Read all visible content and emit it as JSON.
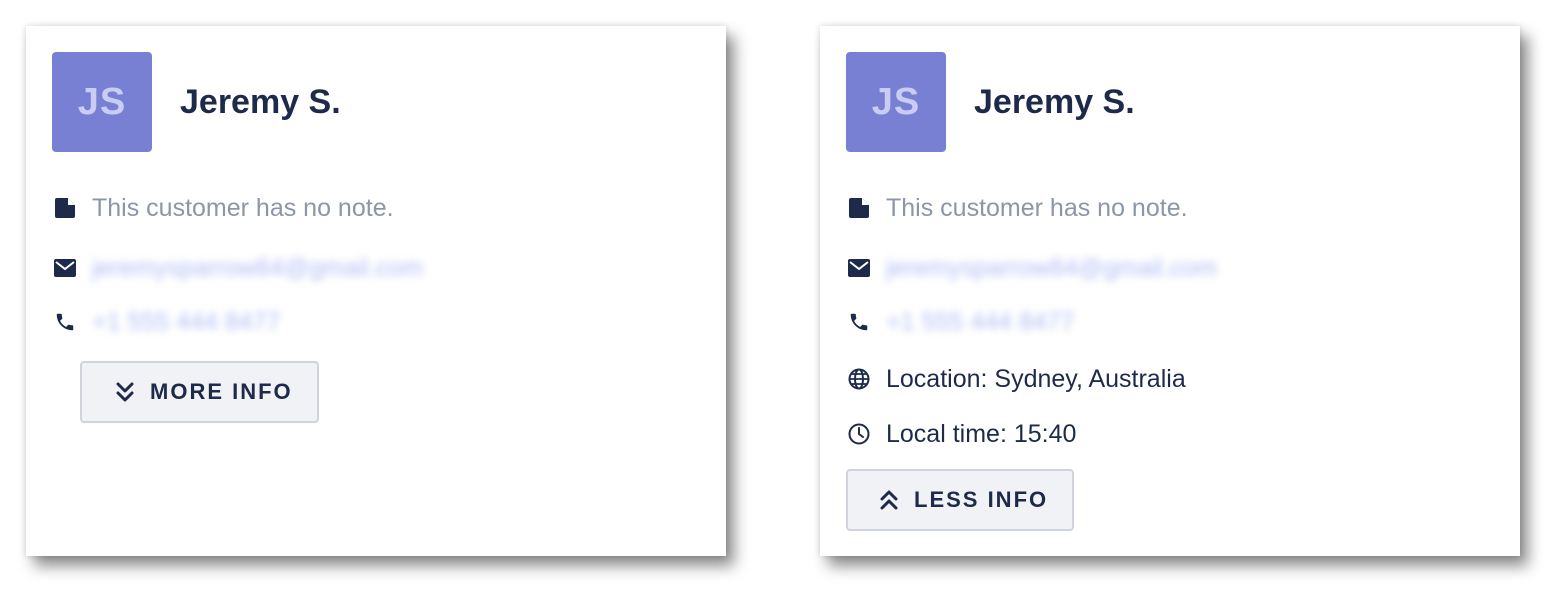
{
  "colors": {
    "avatar_bg": "#7880d4",
    "avatar_text": "#c9ccf3",
    "text_primary": "#1e2a4a",
    "text_muted": "#8d95a8",
    "button_bg": "#f1f2f6"
  },
  "cards": [
    {
      "avatar_initials": "JS",
      "name": "Jeremy S.",
      "note": {
        "icon": "note-icon",
        "text": "This customer has no note."
      },
      "email": {
        "icon": "mail-icon",
        "text": "jeremysparrow84@gmail.com"
      },
      "phone": {
        "icon": "phone-icon",
        "text": "+1 555 444 8477"
      },
      "toggle": {
        "icon": "chevrons-down-icon",
        "label": "MORE INFO"
      }
    },
    {
      "avatar_initials": "JS",
      "name": "Jeremy S.",
      "note": {
        "icon": "note-icon",
        "text": "This customer has no note."
      },
      "email": {
        "icon": "mail-icon",
        "text": "jeremysparrow84@gmail.com"
      },
      "phone": {
        "icon": "phone-icon",
        "text": "+1 555 444 8477"
      },
      "location": {
        "icon": "globe-icon",
        "text": "Location: Sydney, Australia"
      },
      "local_time": {
        "icon": "clock-icon",
        "text": "Local time: 15:40"
      },
      "toggle": {
        "icon": "chevrons-up-icon",
        "label": "LESS INFO"
      }
    }
  ]
}
